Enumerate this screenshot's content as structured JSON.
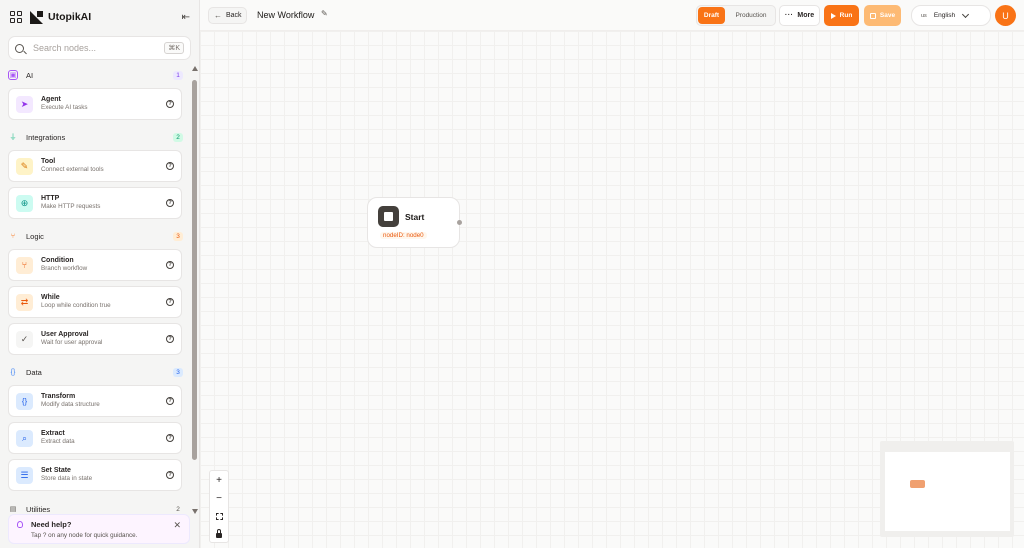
{
  "brand": {
    "name": "UtopikAI"
  },
  "search": {
    "placeholder": "Search nodes...",
    "shortcut": "⌘K"
  },
  "categories": [
    {
      "name": "AI",
      "count": "1",
      "color": "#a855f7"
    },
    {
      "name": "Integrations",
      "count": "2",
      "color": "#10b981"
    },
    {
      "name": "Logic",
      "count": "3",
      "color": "#f97316"
    },
    {
      "name": "Data",
      "count": "3",
      "color": "#3b82f6"
    },
    {
      "name": "Utilities",
      "count": "2",
      "color": "#57534e"
    }
  ],
  "nodes": [
    {
      "title": "Agent",
      "desc": "Execute AI tasks",
      "icon": "send-icon"
    },
    {
      "title": "Tool",
      "desc": "Connect external tools",
      "icon": "wrench-icon"
    },
    {
      "title": "HTTP",
      "desc": "Make HTTP requests",
      "icon": "globe-icon"
    },
    {
      "title": "Condition",
      "desc": "Branch workflow",
      "icon": "branch-icon"
    },
    {
      "title": "While",
      "desc": "Loop while condition true",
      "icon": "loop-icon"
    },
    {
      "title": "User Approval",
      "desc": "Wait for user approval",
      "icon": "check-circle-icon"
    },
    {
      "title": "Transform",
      "desc": "Modify data structure",
      "icon": "braces-icon"
    },
    {
      "title": "Extract",
      "desc": "Extract data",
      "icon": "search-icon"
    },
    {
      "title": "Set State",
      "desc": "Store data in state",
      "icon": "database-icon"
    }
  ],
  "help": {
    "title": "Need help?",
    "text": "Tap ? on any node for quick guidance."
  },
  "toolbar": {
    "back": "Back",
    "workflow_title": "New Workflow",
    "draft": "Draft",
    "production": "Production",
    "more": "More",
    "run": "Run",
    "save": "Save",
    "lang_code": "us",
    "lang": "English",
    "avatar": "U"
  },
  "canvas": {
    "start_label": "Start",
    "start_id": "nodeID: node0"
  },
  "colors": {
    "accent": "#f97316",
    "accent_light": "#fdba74"
  }
}
